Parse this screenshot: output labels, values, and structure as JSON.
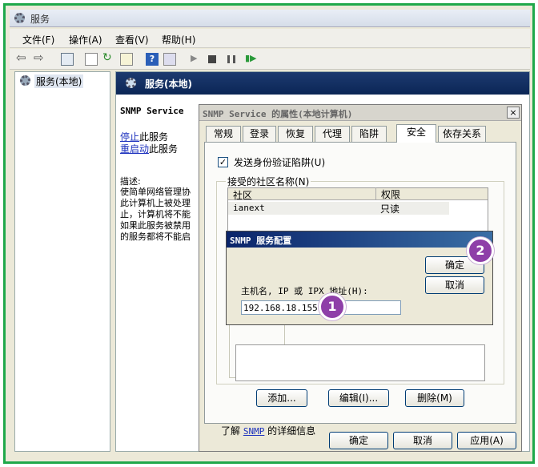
{
  "window": {
    "title": "服务"
  },
  "menu": [
    "文件(F)",
    "操作(A)",
    "查看(V)",
    "帮助(H)"
  ],
  "tree": {
    "root_label": "服务(本地)"
  },
  "content": {
    "banner": "服务(本地)",
    "service_name": "SNMP Service",
    "stop_link": "停止",
    "stop_suffix": "此服务",
    "restart_link": "重启动",
    "restart_suffix": "此服务",
    "desc_label": "描述:",
    "desc_text": "使简单网络管理协此计算机上被处理止，计算机将不能如果此服务被禁用的服务都将不能启"
  },
  "props": {
    "title": "SNMP Service 的属性(本地计算机)",
    "close": "×",
    "tabs": [
      "常规",
      "登录",
      "恢复",
      "代理",
      "陷阱",
      "安全",
      "依存关系"
    ],
    "active_tab": "安全",
    "send_trap_label": "发送身份验证陷阱(U)",
    "send_trap_checked": true,
    "community_group": "接受的社区名称(N)",
    "col_community": "社区",
    "col_rights": "权限",
    "row_community": "ianext",
    "row_rights": "只读",
    "add": "添加...",
    "edit": "编辑(I)...",
    "remove": "删除(M)",
    "learn_prefix": "了解",
    "learn_link": "SNMP",
    "learn_suffix": "的详细信息",
    "ok": "确定",
    "cancel": "取消",
    "apply": "应用(A)"
  },
  "snmp": {
    "title": "SNMP 服务配置",
    "ok": "确定",
    "cancel": "取消",
    "host_label": "主机名, IP 或 IPX 地址(H):",
    "host_value": "192.168.18.155"
  },
  "markers": [
    "1",
    "2"
  ],
  "colors": {
    "frame": "#1fa84a",
    "banner": "#0b2656",
    "marker": "#8e3fa8",
    "link": "#1a2fbd"
  }
}
